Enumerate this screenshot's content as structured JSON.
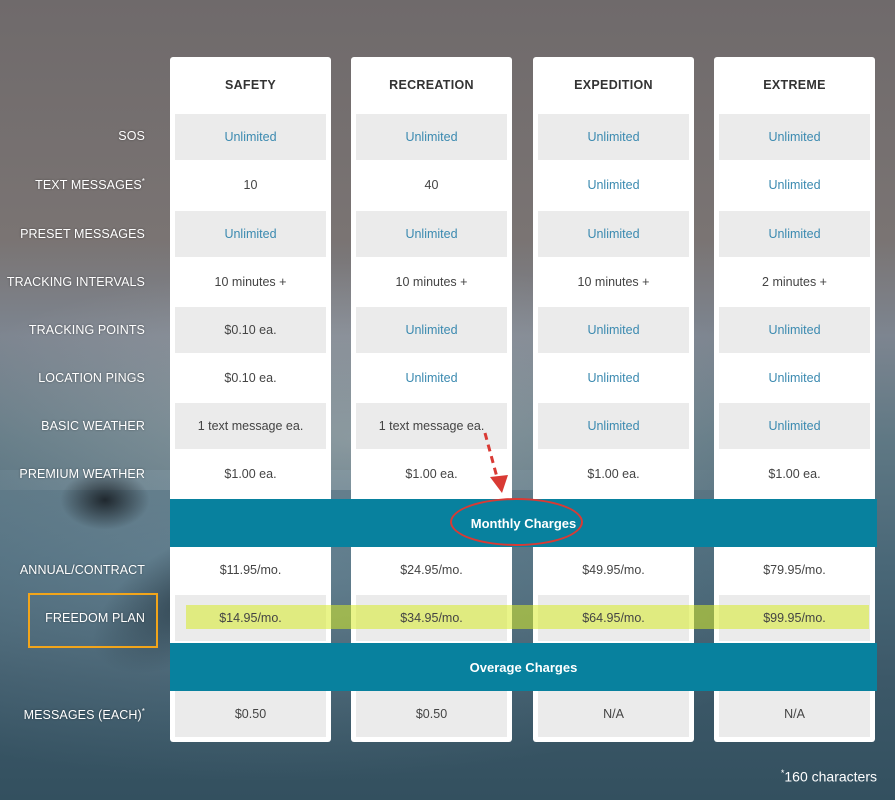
{
  "plans": [
    "SAFETY",
    "RECREATION",
    "EXPEDITION",
    "EXTREME"
  ],
  "rows": [
    {
      "label": "SOS",
      "footnote": "",
      "values": [
        "Unlimited",
        "Unlimited",
        "Unlimited",
        "Unlimited"
      ]
    },
    {
      "label": "TEXT MESSAGES",
      "footnote": "*",
      "values": [
        "10",
        "40",
        "Unlimited",
        "Unlimited"
      ]
    },
    {
      "label": "PRESET MESSAGES",
      "footnote": "",
      "values": [
        "Unlimited",
        "Unlimited",
        "Unlimited",
        "Unlimited"
      ]
    },
    {
      "label": "TRACKING INTERVALS",
      "footnote": "",
      "values": [
        "10 minutes +",
        "10 minutes +",
        "10 minutes +",
        "2 minutes +"
      ]
    },
    {
      "label": "TRACKING POINTS",
      "footnote": "",
      "values": [
        "$0.10 ea.",
        "Unlimited",
        "Unlimited",
        "Unlimited"
      ]
    },
    {
      "label": "LOCATION PINGS",
      "footnote": "",
      "values": [
        "$0.10 ea.",
        "Unlimited",
        "Unlimited",
        "Unlimited"
      ]
    },
    {
      "label": "BASIC WEATHER",
      "footnote": "",
      "values": [
        "1 text message ea.",
        "1 text message ea.",
        "Unlimited",
        "Unlimited"
      ]
    },
    {
      "label": "PREMIUM WEATHER",
      "footnote": "",
      "values": [
        "$1.00 ea.",
        "$1.00 ea.",
        "$1.00 ea.",
        "$1.00 ea."
      ]
    }
  ],
  "monthly_band": "Monthly Charges",
  "monthly_rows": [
    {
      "label": "ANNUAL/CONTRACT",
      "footnote": "",
      "values": [
        "$11.95/mo.",
        "$24.95/mo.",
        "$49.95/mo.",
        "$79.95/mo."
      ]
    },
    {
      "label": "FREEDOM PLAN",
      "footnote": "",
      "values": [
        "$14.95/mo.",
        "$34.95/mo.",
        "$64.95/mo.",
        "$99.95/mo."
      ]
    }
  ],
  "overage_band": "Overage Charges",
  "overage_rows": [
    {
      "label": "MESSAGES (EACH)",
      "footnote": "*",
      "values": [
        "$0.50",
        "$0.50",
        "N/A",
        "N/A"
      ]
    }
  ],
  "footnote": {
    "mark": "*",
    "text": "160 characters"
  },
  "colors": {
    "band": "#08819e",
    "link": "#3b8ab0",
    "annotation_red": "#d93a34",
    "annotation_orange": "#f2a51a",
    "highlight": "#d7eb28"
  }
}
